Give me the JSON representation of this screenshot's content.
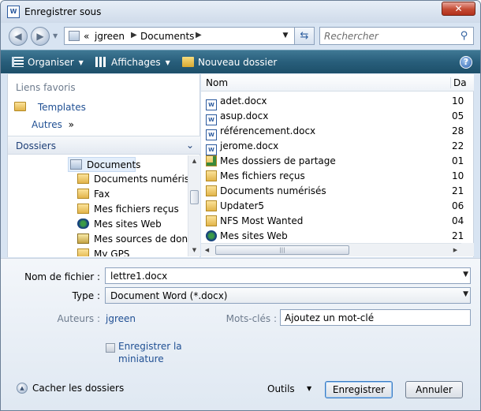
{
  "window": {
    "title": "Enregistrer sous",
    "close_glyph": "✕"
  },
  "nav": {
    "back_glyph": "◀",
    "forward_glyph": "▶"
  },
  "address": {
    "prefix": "«",
    "path": [
      "jgreen",
      "Documents"
    ],
    "separator": "▶"
  },
  "search": {
    "placeholder": "Rechercher"
  },
  "toolbar": {
    "organize": "Organiser",
    "views": "Affichages",
    "new_folder": "Nouveau dossier",
    "help": "?"
  },
  "favorites": {
    "title": "Liens favoris",
    "items": [
      "Templates",
      "Autres"
    ],
    "more_glyph": "»"
  },
  "folders": {
    "title": "Dossiers",
    "items": [
      "Documents",
      "Documents numérisés",
      "Fax",
      "Mes fichiers reçus",
      "Mes sites Web",
      "Mes sources de données",
      "My GPS"
    ]
  },
  "file_list": {
    "columns": {
      "name": "Nom",
      "date": "Da"
    },
    "rows": [
      {
        "name": "adet.docx",
        "date": "10",
        "icon": "word-doc-icon"
      },
      {
        "name": "asup.docx",
        "date": "05",
        "icon": "word-doc-icon"
      },
      {
        "name": "référencement.docx",
        "date": "28",
        "icon": "word-doc-icon"
      },
      {
        "name": "jerome.docx",
        "date": "22",
        "icon": "word-doc-icon"
      },
      {
        "name": "Mes dossiers de partage",
        "date": "01",
        "icon": "shared-folder-icon"
      },
      {
        "name": "Mes fichiers reçus",
        "date": "10",
        "icon": "folder-icon"
      },
      {
        "name": "Documents numérisés",
        "date": "21",
        "icon": "folder-icon"
      },
      {
        "name": "Updater5",
        "date": "06",
        "icon": "folder-icon"
      },
      {
        "name": "NFS Most Wanted",
        "date": "04",
        "icon": "folder-icon"
      },
      {
        "name": "Mes sites Web",
        "date": "21",
        "icon": "globe-folder-icon"
      }
    ]
  },
  "form": {
    "filename_label": "Nom de fichier :",
    "filename_value": "lettre1.docx",
    "type_label": "Type :",
    "type_value": "Document Word (*.docx)",
    "authors_label": "Auteurs :",
    "authors_value": "jgreen",
    "keywords_label": "Mots-clés :",
    "keywords_value": "Ajoutez un mot-clé",
    "thumbnail_label_1": "Enregistrer la",
    "thumbnail_label_2": "miniature",
    "hide_folders": "Cacher les dossiers",
    "tools": "Outils",
    "save": "Enregistrer",
    "cancel": "Annuler"
  }
}
